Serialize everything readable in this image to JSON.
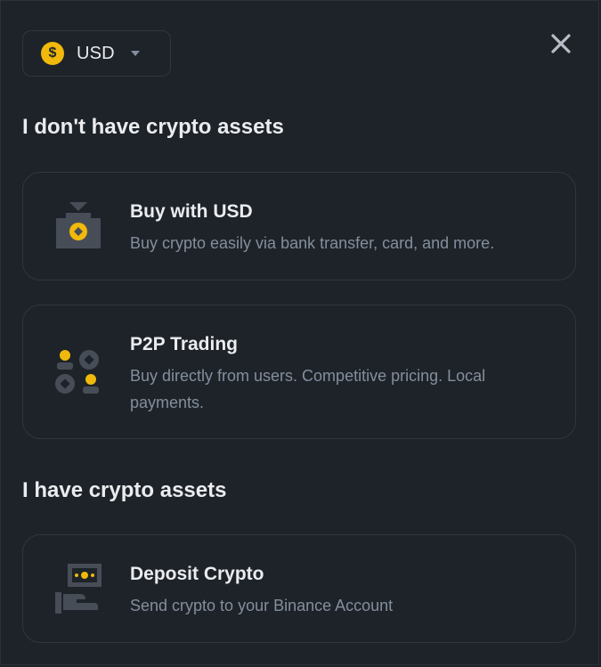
{
  "currency": {
    "symbol": "$",
    "code": "USD"
  },
  "sections": [
    {
      "title": "I don't have crypto assets",
      "options": [
        {
          "title": "Buy with USD",
          "description": "Buy crypto easily via bank transfer, card, and more.",
          "icon": "buy-crypto-icon"
        },
        {
          "title": "P2P Trading",
          "description": "Buy directly from users. Competitive pricing. Local payments.",
          "icon": "p2p-trading-icon"
        }
      ]
    },
    {
      "title": "I have crypto assets",
      "options": [
        {
          "title": "Deposit Crypto",
          "description": "Send crypto to your Binance Account",
          "icon": "deposit-crypto-icon"
        }
      ]
    }
  ],
  "colors": {
    "background": "#1E2329",
    "accent": "#F0B90B",
    "icon_gray": "#474D57",
    "text_primary": "#EAECEF",
    "text_secondary": "#848E9C",
    "border": "#2F3640"
  }
}
